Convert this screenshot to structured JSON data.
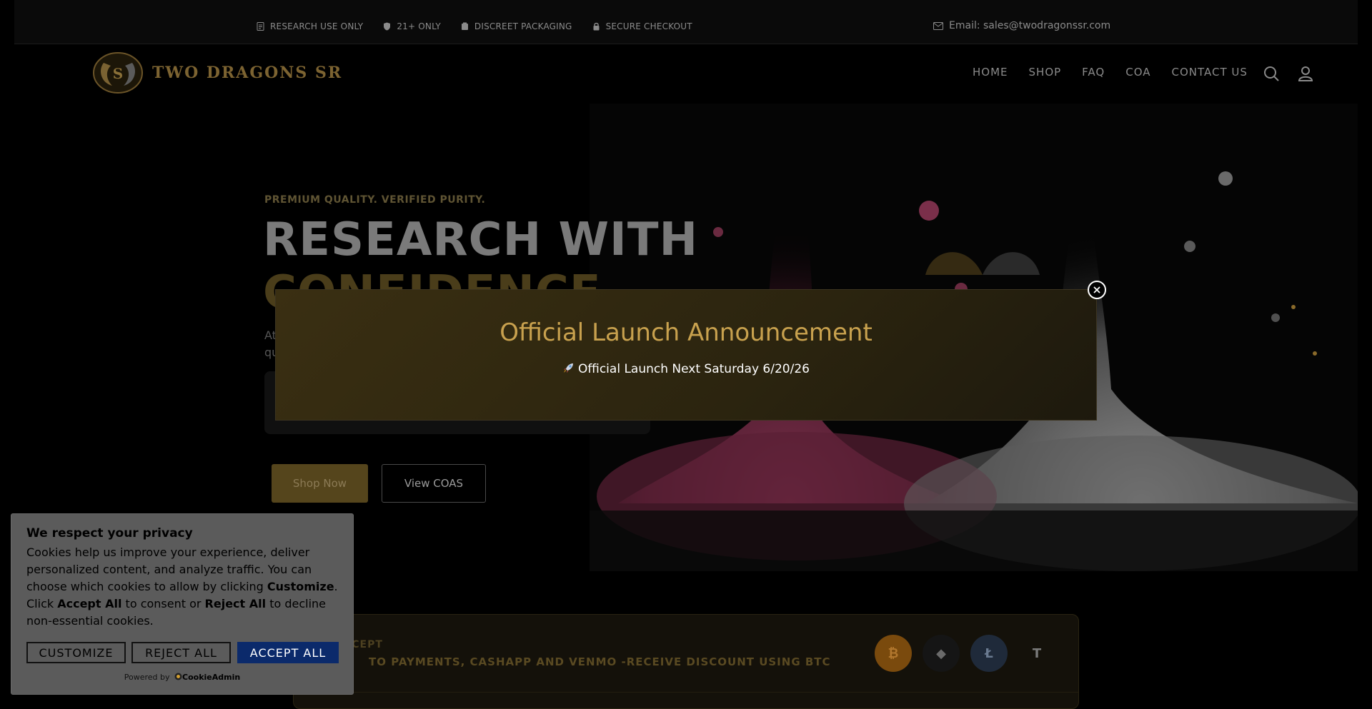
{
  "topbar": {
    "badges": [
      {
        "icon": "document-icon",
        "label": "RESEARCH USE ONLY"
      },
      {
        "icon": "shield-icon",
        "label": "21+ ONLY"
      },
      {
        "icon": "box-icon",
        "label": "DISCREET PACKAGING"
      },
      {
        "icon": "lock-icon",
        "label": "SECURE CHECKOUT"
      }
    ],
    "email": "Email: sales@twodragonssr.com"
  },
  "header": {
    "logo_text": "TWO DRAGONS SR",
    "nav": [
      "HOME",
      "SHOP",
      "FAQ",
      "COA",
      "CONTACT US"
    ]
  },
  "hero": {
    "eyebrow": "PREMIUM QUALITY. VERIFIED PURITY.",
    "headline_1": "RESEARCH WITH",
    "headline_2": "CONFIDENCE",
    "sub_1": "At",
    "sub_2": "qu",
    "shop_button": "Shop Now",
    "coas_button": "View COAS"
  },
  "payments": {
    "title": "CCEPT",
    "text": "TO PAYMENTS, CASHAPP AND VENMO -RECEIVE DISCOUNT USING BTC",
    "coins": [
      {
        "symbol": "₿",
        "name": "bitcoin",
        "color": "#f7931a"
      },
      {
        "symbol": "◆",
        "name": "ethereum",
        "color": "#3a3a3a"
      },
      {
        "symbol": "Ł",
        "name": "litecoin",
        "color": "#345d9d"
      },
      {
        "symbol": "T",
        "name": "tether",
        "color": "#1a1a1a"
      }
    ]
  },
  "modal": {
    "title": "Official Launch Announcement",
    "message": "Official Launch Next Saturday 6/20/26"
  },
  "cookie": {
    "title": "We respect your privacy",
    "body_1": "Cookies help us improve your experience, deliver personalized content, and analyze traffic. You can choose which cookies to allow by clicking ",
    "body_customize": "Customize",
    "body_2": ". Click ",
    "body_accept": "Accept All",
    "body_3": " to consent or ",
    "body_reject": "Reject All",
    "body_4": " to decline non-essential cookies.",
    "customize_button": "CUSTOMIZE",
    "reject_button": "REJECT ALL",
    "accept_button": "ACCEPT ALL",
    "powered_by": "Powered by",
    "powered_brand": "CookieAdmin"
  }
}
